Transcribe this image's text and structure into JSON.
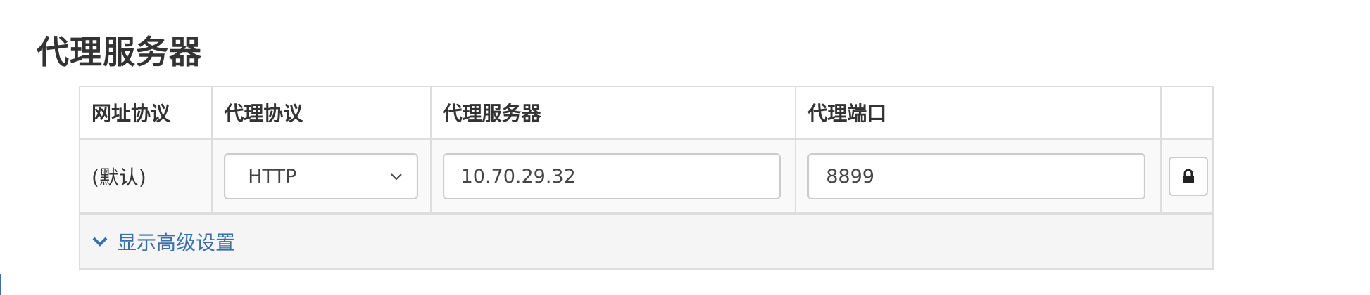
{
  "page": {
    "title": "代理服务器"
  },
  "table": {
    "headers": {
      "scheme": "网址协议",
      "protocol": "代理协议",
      "server": "代理服务器",
      "port": "代理端口",
      "action": ""
    },
    "rows": [
      {
        "scheme": "(默认)",
        "protocol": "HTTP",
        "server": "10.70.29.32",
        "port": "8899"
      }
    ]
  },
  "advanced": {
    "label": "显示高级设置"
  },
  "icons": {
    "lock": "lock-icon",
    "chevron": "chevron-down-icon"
  },
  "colors": {
    "link": "#3a6fa8",
    "border": "#dddddd"
  }
}
